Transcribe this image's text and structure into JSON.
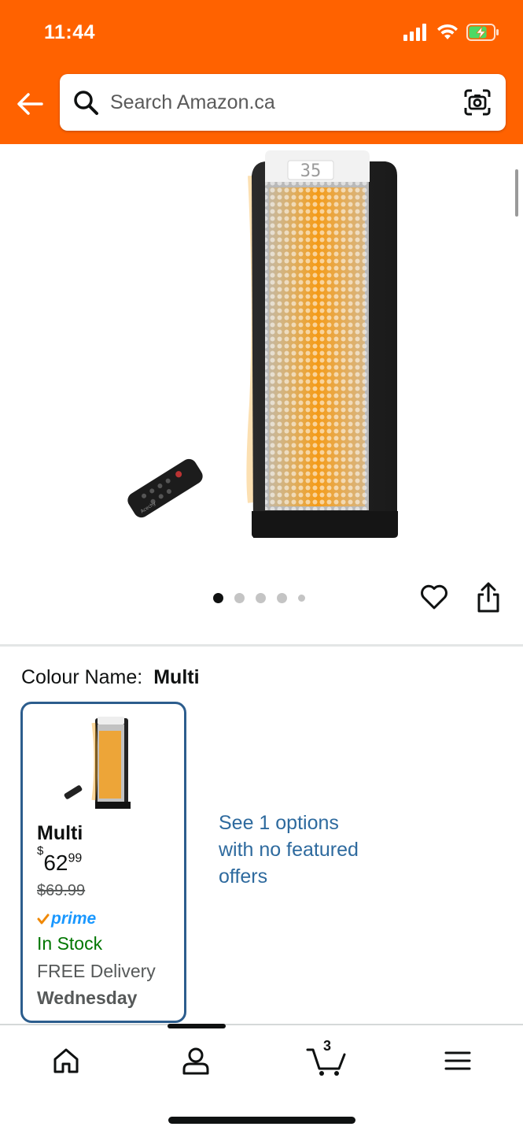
{
  "status_bar": {
    "time": "11:44"
  },
  "search": {
    "placeholder": "Search Amazon.ca"
  },
  "gallery": {
    "image_count": 5,
    "active_index": 0
  },
  "product": {
    "colour_label": "Colour Name:",
    "colour_value": "Multi"
  },
  "variant": {
    "name": "Multi",
    "currency": "$",
    "price_whole": "62",
    "price_cents": "99",
    "old_price": "$69.99",
    "prime_label": "prime",
    "stock": "In Stock",
    "delivery": "FREE Delivery",
    "delivery_day": "Wednesday"
  },
  "options_link": "See 1 options with no featured offers",
  "tabbar": {
    "cart_count": "3",
    "items": [
      "home-icon",
      "account-icon",
      "cart-icon",
      "menu-icon"
    ]
  },
  "colors": {
    "header": "#ff6200",
    "selected_border": "#2c5d8d",
    "link": "#2e6a9e",
    "in_stock": "#007600",
    "prime_blue": "#1a98ff",
    "prime_check": "#f08804"
  },
  "remote_brand": "Acechy",
  "heater_display": "35"
}
